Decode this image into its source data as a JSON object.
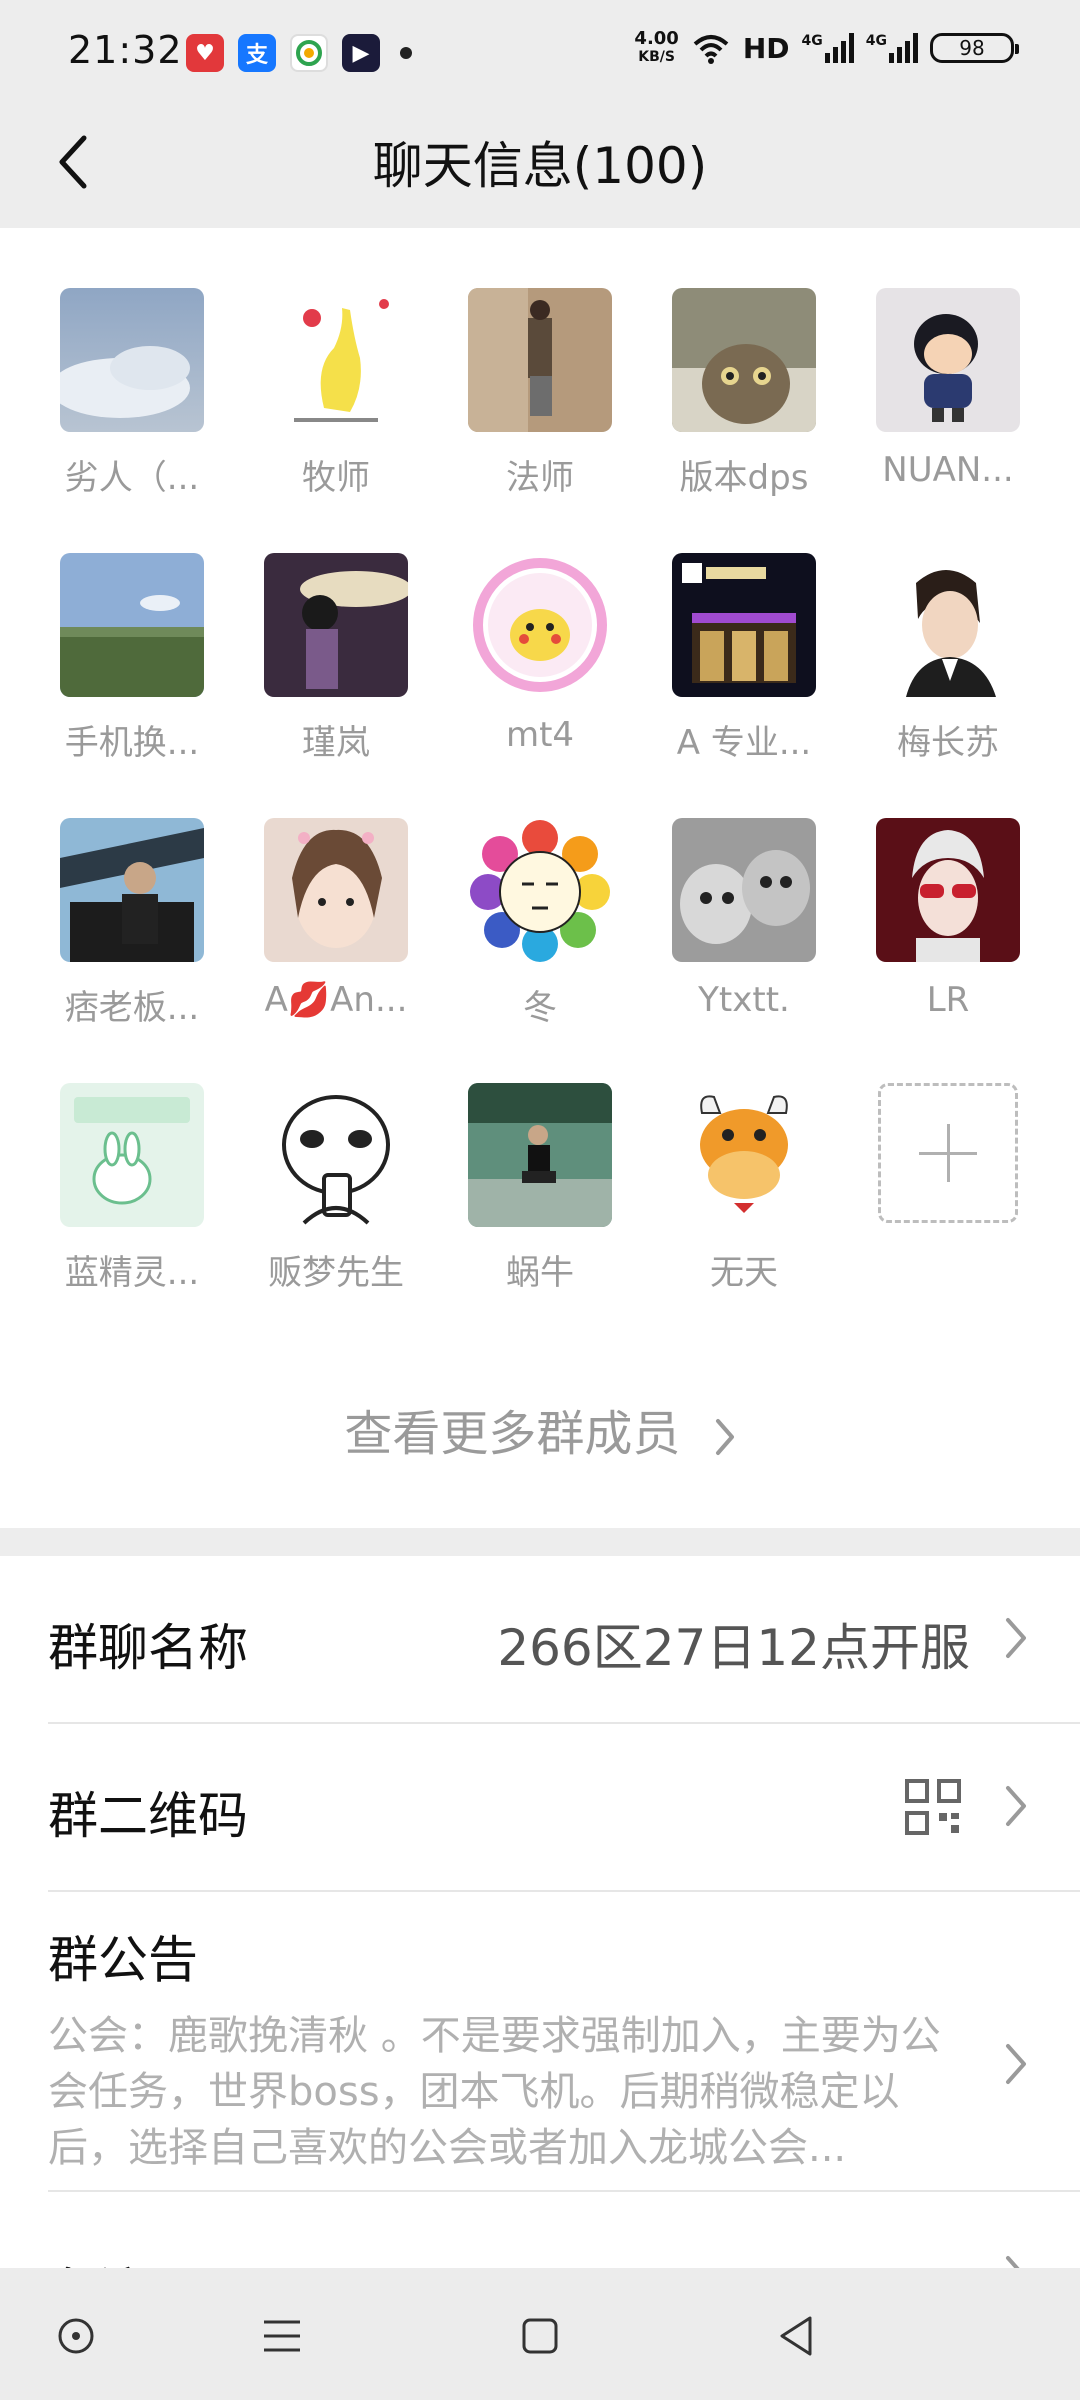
{
  "status_bar": {
    "time": "21:32",
    "net_speed": "4.00",
    "net_unit": "KB/S",
    "hd": "HD",
    "sig1": "4G",
    "sig2": "4G",
    "battery": "98"
  },
  "header": {
    "title": "聊天信息(100)"
  },
  "members": [
    {
      "name": "劣人（..."
    },
    {
      "name": "牧师"
    },
    {
      "name": "法师"
    },
    {
      "name": "版本dps"
    },
    {
      "name": "NUAN..."
    },
    {
      "name": "手机换..."
    },
    {
      "name": "瑾岚"
    },
    {
      "name": "mt4"
    },
    {
      "name": "A 专业..."
    },
    {
      "name": "梅长苏"
    },
    {
      "name": "痞老板..."
    },
    {
      "name": "A💋An..."
    },
    {
      "name": "冬"
    },
    {
      "name": "Ytxtt."
    },
    {
      "name": "LR"
    },
    {
      "name": "蓝精灵..."
    },
    {
      "name": "贩梦先生"
    },
    {
      "name": "蜗牛"
    },
    {
      "name": "无天"
    }
  ],
  "more_members": "查看更多群成员",
  "settings": {
    "group_name_label": "群聊名称",
    "group_name_value": "266区27日12点开服",
    "qr_label": "群二维码",
    "notice_label": "群公告",
    "notice_text": "公会：鹿歌挽清秋 。不是要求强制加入，主要为公会任务，世界boss，团本飞机。后期稍微稳定以后，选择自己喜欢的公会或者加入龙城公会...",
    "remark_label": "备注"
  },
  "colors": {
    "background_gray": "#ededed",
    "secondary_text": "#9a9a9a"
  }
}
